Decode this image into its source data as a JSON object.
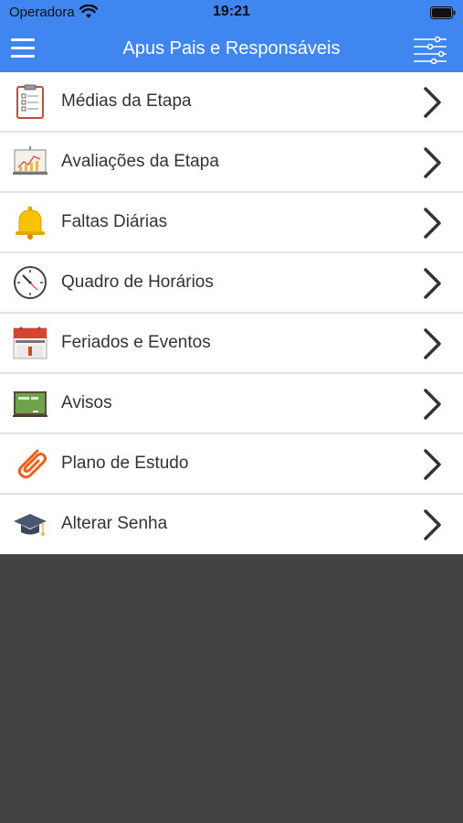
{
  "status_bar": {
    "carrier": "Operadora",
    "time": "19:21"
  },
  "nav_bar": {
    "title": "Apus Pais e Responsáveis"
  },
  "menu": {
    "items": [
      {
        "label": "Médias da Etapa",
        "icon": "clipboard-icon"
      },
      {
        "label": "Avaliações da Etapa",
        "icon": "chart-board-icon"
      },
      {
        "label": "Faltas Diárias",
        "icon": "bell-icon"
      },
      {
        "label": "Quadro de Horários",
        "icon": "clock-icon"
      },
      {
        "label": "Feriados e Eventos",
        "icon": "calendar-icon"
      },
      {
        "label": "Avisos",
        "icon": "chalkboard-icon"
      },
      {
        "label": "Plano de Estudo",
        "icon": "paperclip-icon"
      },
      {
        "label": "Alterar Senha",
        "icon": "graduation-cap-icon"
      }
    ]
  },
  "colors": {
    "accent": "#3f86f0",
    "background": "#434343"
  }
}
